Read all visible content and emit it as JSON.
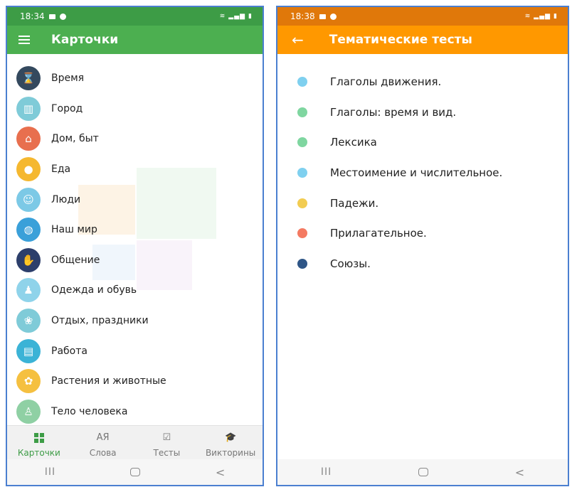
{
  "left_screen": {
    "status": {
      "time": "18:34"
    },
    "app_bar": {
      "title": "Карточки",
      "menu_icon": "menu-icon"
    },
    "cards": [
      {
        "label": "Время",
        "icon": "hourglass-icon",
        "color": "#34495e",
        "glyph": "⌛"
      },
      {
        "label": "Город",
        "icon": "city-icon",
        "color": "#7fcbd8",
        "glyph": "▥"
      },
      {
        "label": "Дом, быт",
        "icon": "house-icon",
        "color": "#e86f4e",
        "glyph": "⌂"
      },
      {
        "label": "Еда",
        "icon": "apple-icon",
        "color": "#f5b830",
        "glyph": "●"
      },
      {
        "label": "Люди",
        "icon": "people-icon",
        "color": "#7cc9e6",
        "glyph": "☺"
      },
      {
        "label": "Наш мир",
        "icon": "globe-icon",
        "color": "#3aa0d9",
        "glyph": "◍"
      },
      {
        "label": "Общение",
        "icon": "handshake-icon",
        "color": "#2c3e6b",
        "glyph": "✋"
      },
      {
        "label": "Одежда и обувь",
        "icon": "shirt-icon",
        "color": "#8fd3ea",
        "glyph": "♟"
      },
      {
        "label": "Отдых, праздники",
        "icon": "balloons-icon",
        "color": "#7fcbd8",
        "glyph": "❀"
      },
      {
        "label": "Работа",
        "icon": "briefcase-icon",
        "color": "#3bb3d6",
        "glyph": "▤"
      },
      {
        "label": "Растения и животные",
        "icon": "dog-icon",
        "color": "#f5c040",
        "glyph": "✿"
      },
      {
        "label": "Тело человека",
        "icon": "body-icon",
        "color": "#8fd0a4",
        "glyph": "♙"
      }
    ],
    "bottom_nav": [
      {
        "label": "Карточки",
        "icon": "cards-grid-icon",
        "active": true,
        "glyph": ""
      },
      {
        "label": "Слова",
        "icon": "words-icon",
        "active": false,
        "glyph": "АЯ"
      },
      {
        "label": "Тесты",
        "icon": "tests-icon",
        "active": false,
        "glyph": "☑"
      },
      {
        "label": "Викторины",
        "icon": "quiz-icon",
        "active": false,
        "glyph": "🎓"
      }
    ]
  },
  "right_screen": {
    "status": {
      "time": "18:38"
    },
    "app_bar": {
      "title": "Тематические тесты",
      "back_icon": "back-arrow-icon"
    },
    "tests": [
      {
        "label": "Глаголы движения.",
        "color": "#7fd0ef"
      },
      {
        "label": "Глаголы: время и вид.",
        "color": "#7fd6a0"
      },
      {
        "label": "Лексика",
        "color": "#7fd6a0"
      },
      {
        "label": "Местоимение и числительное.",
        "color": "#7fd0ef"
      },
      {
        "label": "Падежи.",
        "color": "#f2cc52"
      },
      {
        "label": "Прилагательное.",
        "color": "#f47a62"
      },
      {
        "label": "Союзы.",
        "color": "#2f5687"
      }
    ]
  },
  "system_nav": {
    "recent": "III",
    "home": "",
    "back": "<"
  }
}
